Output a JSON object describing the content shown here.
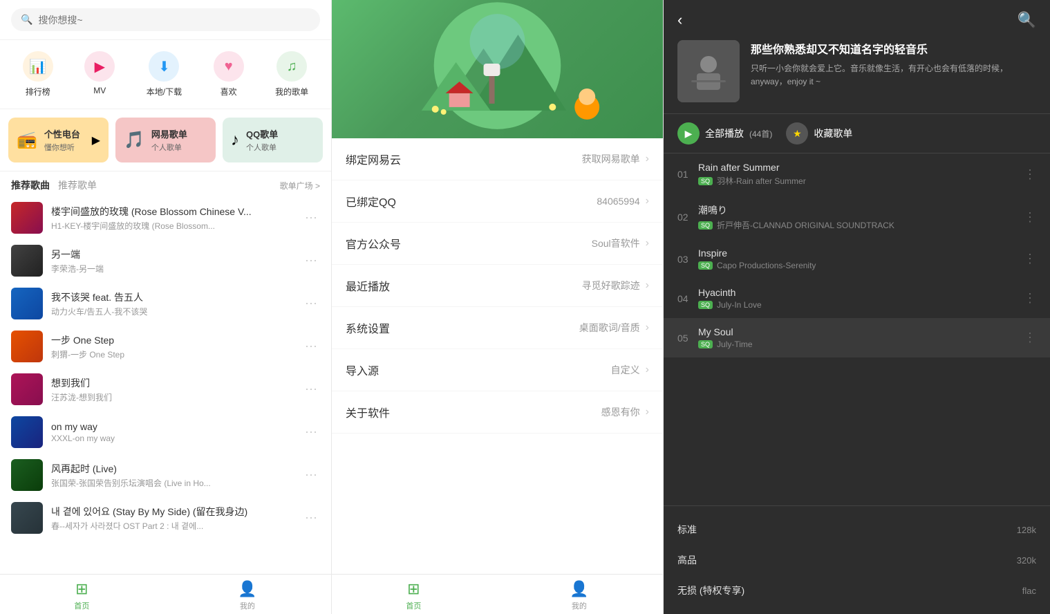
{
  "left": {
    "search_placeholder": "搜你想搜~",
    "quick_nav": [
      {
        "id": "ranking",
        "label": "排行榜",
        "icon": "📊",
        "color_class": "icon-ranking"
      },
      {
        "id": "mv",
        "label": "MV",
        "icon": "▶",
        "color_class": "icon-mv"
      },
      {
        "id": "download",
        "label": "本地/下载",
        "icon": "⬇",
        "color_class": "icon-download"
      },
      {
        "id": "favorite",
        "label": "喜欢",
        "icon": "♥",
        "color_class": "icon-favorite"
      },
      {
        "id": "mylist",
        "label": "我的歌单",
        "icon": "♫",
        "color_class": "icon-mylist"
      }
    ],
    "stations": [
      {
        "id": "personal",
        "title": "个性电台",
        "sub": "懂你想听",
        "icon": "📻",
        "badge": "▶",
        "color_class": "personal"
      },
      {
        "id": "netease",
        "title": "网易歌单",
        "sub": "个人歌单",
        "icon": "🎵",
        "badge": "",
        "color_class": "netease"
      },
      {
        "id": "qq",
        "title": "QQ歌单",
        "sub": "个人歌单",
        "icon": "♪",
        "badge": "",
        "color_class": "qq"
      }
    ],
    "recommend_tabs": [
      {
        "label": "推荐歌曲",
        "active": true
      },
      {
        "label": "推荐歌单",
        "active": false
      }
    ],
    "more_label": "歌单广场 >",
    "songs": [
      {
        "title": "楼宇间盛放的玫瑰 (Rose Blossom Chinese V...",
        "artist": "H1-KEY-楼宇间盛放的玫瑰 (Rose Blossom...",
        "thumb_class": "thumb-1"
      },
      {
        "title": "另一端",
        "artist": "李荣浩-另一端",
        "thumb_class": "thumb-2"
      },
      {
        "title": "我不该哭 feat. 告五人",
        "artist": "动力火车/告五人-我不该哭",
        "thumb_class": "thumb-3"
      },
      {
        "title": "一步 One Step",
        "artist": "刺猬-一步 One Step",
        "thumb_class": "thumb-4"
      },
      {
        "title": "想到我们",
        "artist": "汪苏泷-想到我们",
        "thumb_class": "thumb-5"
      },
      {
        "title": "on my way",
        "artist": "XXXL-on my way",
        "thumb_class": "thumb-6"
      },
      {
        "title": "风再起时 (Live)",
        "artist": "张国荣-张国荣告别乐坛演唱会 (Live in Ho...",
        "thumb_class": "thumb-7"
      },
      {
        "title": "내 곁에 있어요 (Stay By My Side) (留在我身边)",
        "artist": "春--세자가 사라졌다 OST Part 2 : 내 곁에...",
        "thumb_class": "thumb-8"
      }
    ],
    "bottom_nav": [
      {
        "label": "首页",
        "icon": "⊞",
        "active": true
      },
      {
        "label": "我的",
        "icon": "👤",
        "active": false
      }
    ]
  },
  "middle": {
    "menu_items": [
      {
        "label": "绑定网易云",
        "value": "获取网易歌单"
      },
      {
        "label": "已绑定QQ",
        "value": "84065994"
      },
      {
        "label": "官方公众号",
        "value": "Soul音软件"
      },
      {
        "label": "最近播放",
        "value": "寻觅好歌踪迹"
      },
      {
        "label": "系统设置",
        "value": "桌面歌词/音质"
      },
      {
        "label": "导入源",
        "value": "自定义"
      },
      {
        "label": "关于软件",
        "value": "感恩有你"
      }
    ],
    "bottom_nav": [
      {
        "label": "首页",
        "icon": "⊞",
        "active": true
      },
      {
        "label": "我的",
        "icon": "👤",
        "active": false
      }
    ]
  },
  "right": {
    "playlist_title": "那些你熟悉却又不知道名字的轻音乐",
    "playlist_desc": "只听一小会你就会爱上它。音乐就像生活，有开心也会有低落的时候，anyway，enjoy it ~",
    "play_all_label": "全部播放",
    "play_count": "(44首)",
    "collect_label": "收藏歌单",
    "tracks": [
      {
        "num": "01",
        "title": "Rain after Summer",
        "artist": "羽林-Rain after Summer",
        "badge": "SQ"
      },
      {
        "num": "02",
        "title": "潮鳴り",
        "artist": "折戸伸吾-CLANNAD ORIGINAL SOUNDTRACK",
        "badge": "SQ"
      },
      {
        "num": "03",
        "title": "Inspire",
        "artist": "Capo Productions-Serenity",
        "badge": "SQ"
      },
      {
        "num": "04",
        "title": "Hyacinth",
        "artist": "July-In Love",
        "badge": "SQ"
      },
      {
        "num": "05",
        "title": "My Soul",
        "artist": "July-Time",
        "badge": "SQ"
      }
    ],
    "quality_items": [
      {
        "label": "标准",
        "value": "128k"
      },
      {
        "label": "高品",
        "value": "320k"
      },
      {
        "label": "无损 (特权专享)",
        "value": "flac"
      }
    ]
  }
}
